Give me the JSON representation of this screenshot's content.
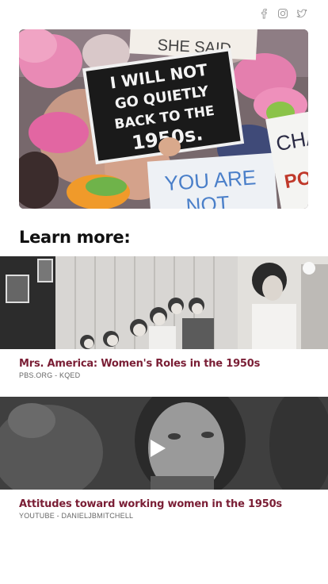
{
  "social": {
    "facebook_icon": "facebook-icon",
    "instagram_icon": "instagram-icon",
    "twitter_icon": "twitter-icon"
  },
  "hero": {
    "sign_text": [
      "I WILL NOT",
      "GO QUIETLY",
      "BACK TO THE",
      "1950s."
    ],
    "background_signs": [
      "SHE SAID",
      "YOU ARE",
      "NOT",
      "CHA",
      "PO"
    ]
  },
  "learn_more": {
    "title": "Learn more:"
  },
  "cards": [
    {
      "title": "Mrs. America: Women's Roles in the 1950s",
      "source": "PBS.ORG - KQED"
    },
    {
      "title": "Attitudes toward working women in the 1950s",
      "source": "YOUTUBE - DANIELJBMITCHELL",
      "play_icon": "play-icon"
    }
  ],
  "colors": {
    "title_accent": "#7a1e35",
    "icon_gray": "#9a9a9a",
    "hat_pink": "#e96aa4"
  }
}
